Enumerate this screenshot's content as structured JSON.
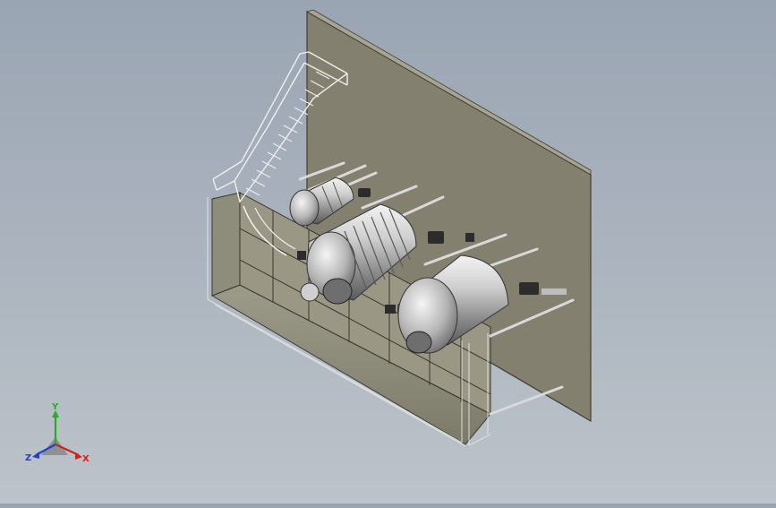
{
  "triad": {
    "x_label": "X",
    "y_label": "Y",
    "z_label": "Z",
    "colors": {
      "x": "#d02020",
      "y": "#20b020",
      "z": "#2040d0"
    }
  },
  "model": {
    "icon": "brewery-tank-assembly-3d",
    "panel_color": "#84806f",
    "steel_color": "#c9c9c9"
  }
}
